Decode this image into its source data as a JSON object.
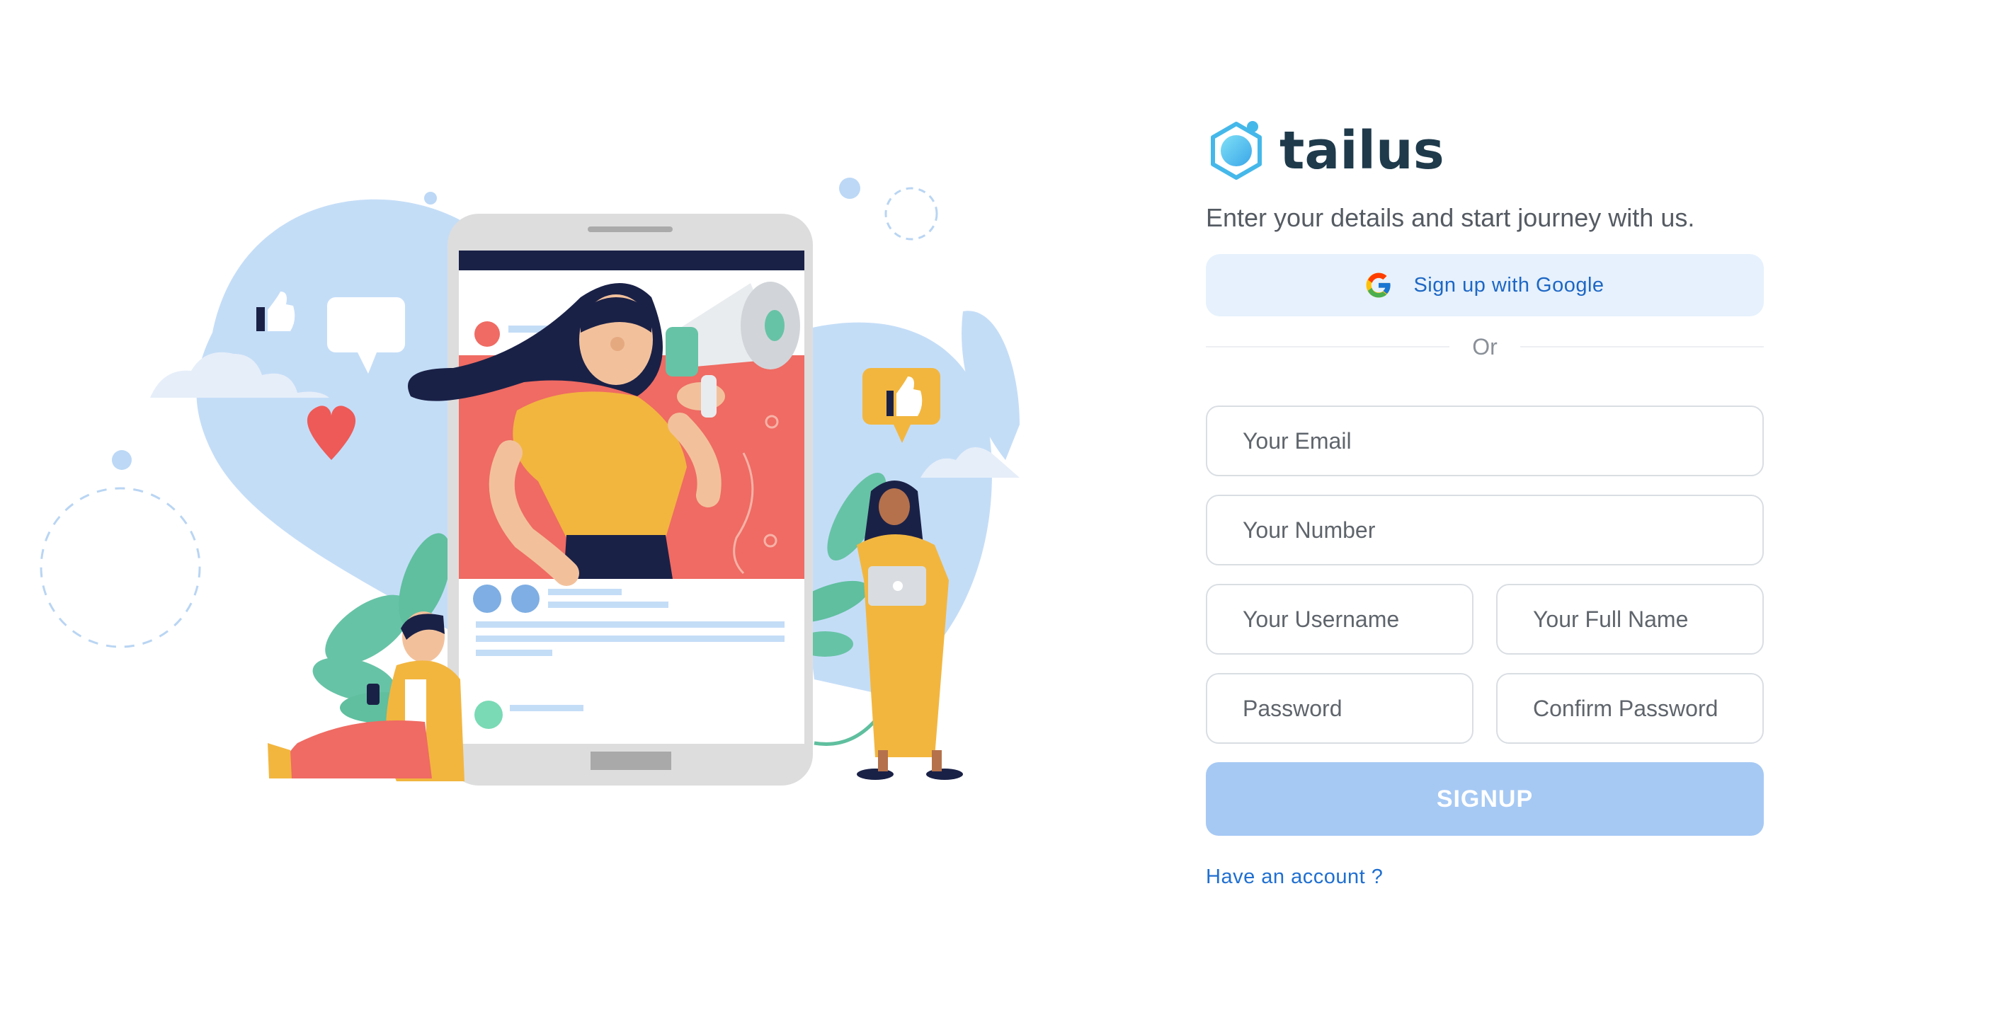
{
  "brand": {
    "name": "tailus"
  },
  "tagline": "Enter your details and start journey with us.",
  "google_button": {
    "label": "Sign up with Google"
  },
  "divider": {
    "label": "Or"
  },
  "form": {
    "email_placeholder": "Your Email",
    "number_placeholder": "Your Number",
    "username_placeholder": "Your Username",
    "fullname_placeholder": "Your Full Name",
    "password_placeholder": "Password",
    "confirm_placeholder": "Confirm Password",
    "submit_label": "SIGNUP"
  },
  "account_link": "Have an account ?",
  "colors": {
    "brand_dark": "#1e3a4b",
    "accent_blue": "#1e67c4",
    "google_bg": "#e6f1fd",
    "signup_bg": "#a6c9f4",
    "logo_cyan": "#4cc9ef"
  }
}
